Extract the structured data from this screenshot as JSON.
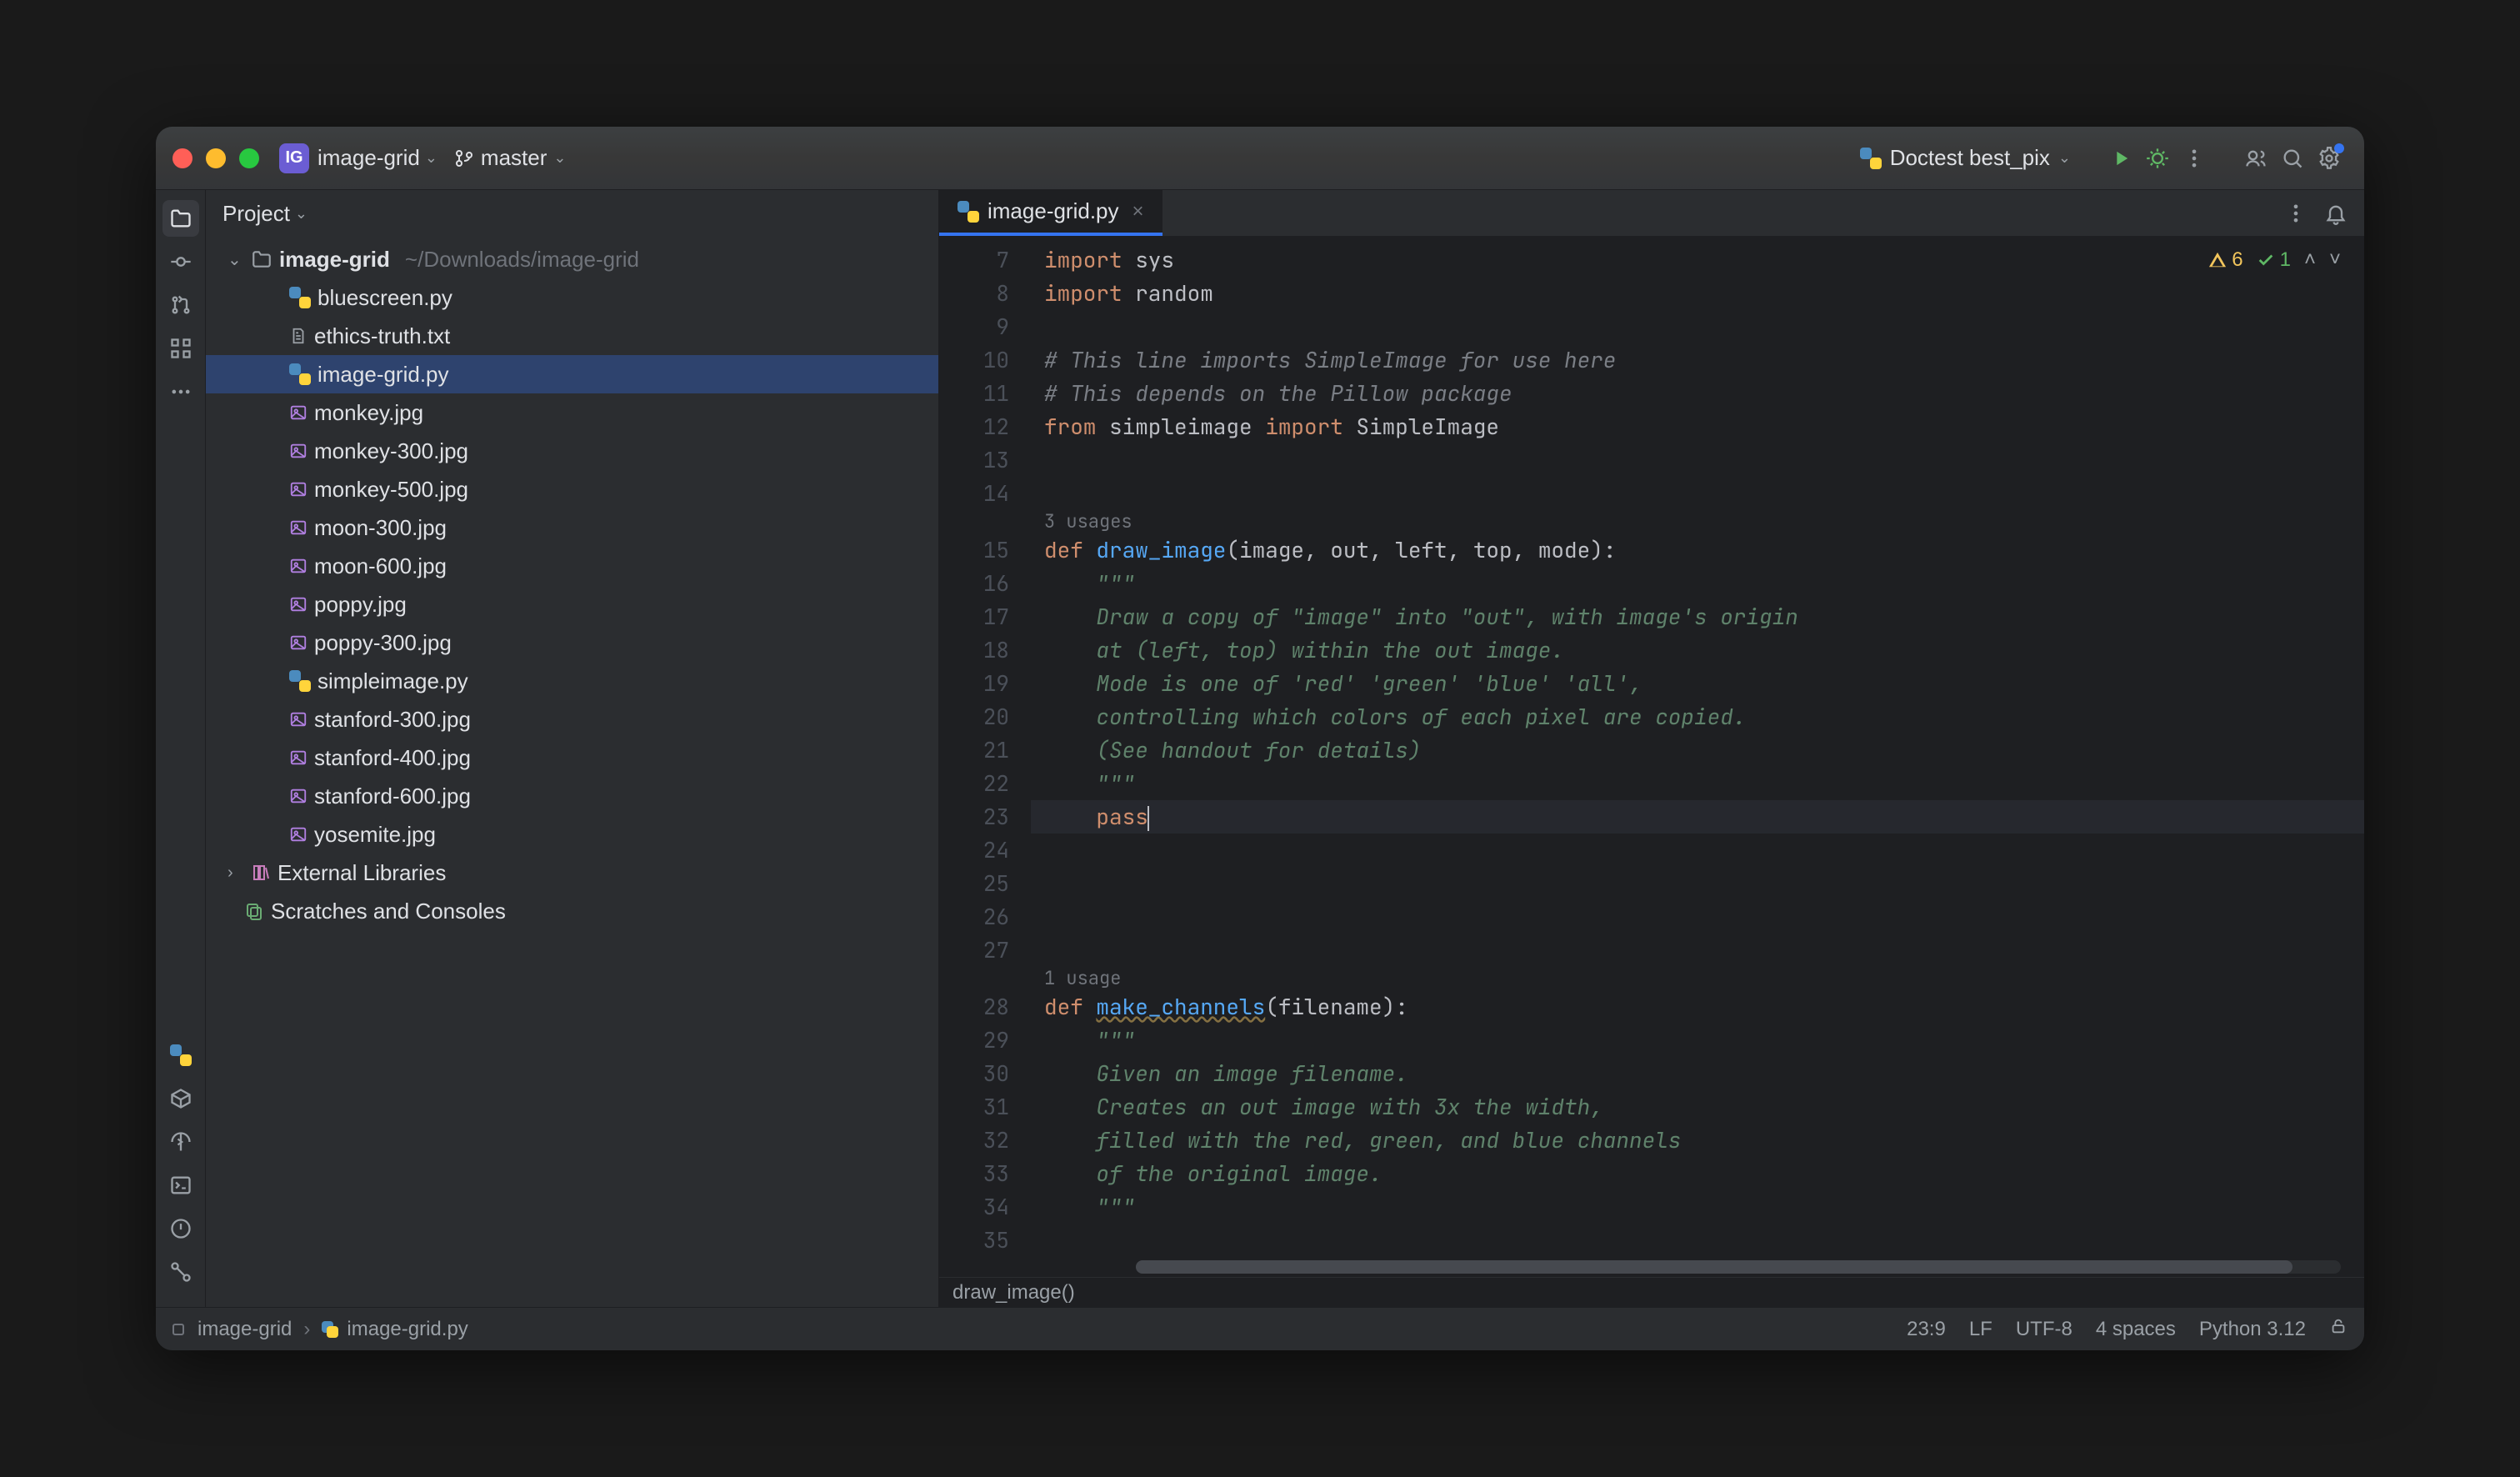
{
  "titlebar": {
    "project_badge": "IG",
    "project_name": "image-grid",
    "branch": "master",
    "run_config": "Doctest best_pix"
  },
  "project_panel": {
    "title": "Project",
    "root_name": "image-grid",
    "root_path": "~/Downloads/image-grid",
    "files": [
      {
        "name": "bluescreen.py",
        "type": "py"
      },
      {
        "name": "ethics-truth.txt",
        "type": "txt"
      },
      {
        "name": "image-grid.py",
        "type": "py",
        "selected": true
      },
      {
        "name": "monkey.jpg",
        "type": "img"
      },
      {
        "name": "monkey-300.jpg",
        "type": "img"
      },
      {
        "name": "monkey-500.jpg",
        "type": "img"
      },
      {
        "name": "moon-300.jpg",
        "type": "img"
      },
      {
        "name": "moon-600.jpg",
        "type": "img"
      },
      {
        "name": "poppy.jpg",
        "type": "img"
      },
      {
        "name": "poppy-300.jpg",
        "type": "img"
      },
      {
        "name": "simpleimage.py",
        "type": "py"
      },
      {
        "name": "stanford-300.jpg",
        "type": "img"
      },
      {
        "name": "stanford-400.jpg",
        "type": "img"
      },
      {
        "name": "stanford-600.jpg",
        "type": "img"
      },
      {
        "name": "yosemite.jpg",
        "type": "img"
      }
    ],
    "external_libs": "External Libraries",
    "scratches": "Scratches and Consoles"
  },
  "tab": {
    "name": "image-grid.py"
  },
  "inspection": {
    "warnings": "6",
    "oks": "1"
  },
  "code": {
    "usages1": "3 usages",
    "usages2": "1 usage",
    "l7_a": "import",
    "l7_b": " sys",
    "l8_a": "import",
    "l8_b": " random",
    "l10": "# This line imports SimpleImage for use here",
    "l11": "# This depends on the Pillow package",
    "l12_a": "from",
    "l12_b": " simpleimage ",
    "l12_c": "import",
    "l12_d": " SimpleImage",
    "l15_a": "def ",
    "l15_b": "draw_image",
    "l15_c": "(image, out, left, top, mode):",
    "l16": "    \"\"\"",
    "l17": "    Draw a copy of \"image\" into \"out\", with image's origin",
    "l18": "    at (left, top) within the out image.",
    "l19": "    Mode is one of 'red' 'green' 'blue' 'all',",
    "l20": "    controlling which colors of each pixel are copied.",
    "l21": "    (See handout for details)",
    "l22": "    \"\"\"",
    "l23_a": "    ",
    "l23_b": "pass",
    "l28_a": "def ",
    "l28_b": "make_channels",
    "l28_c": "(filename):",
    "l29": "    \"\"\"",
    "l30": "    Given an image filename.",
    "l31": "    Creates an out image with 3x the width,",
    "l32": "    filled with the red, green, and blue channels",
    "l33": "    of the original image.",
    "l34": "    \"\"\""
  },
  "breadcrumb": "draw_image()",
  "status": {
    "module": "image-grid",
    "file": "image-grid.py",
    "pos": "23:9",
    "eol": "LF",
    "enc": "UTF-8",
    "indent": "4 spaces",
    "interpreter": "Python 3.12"
  }
}
